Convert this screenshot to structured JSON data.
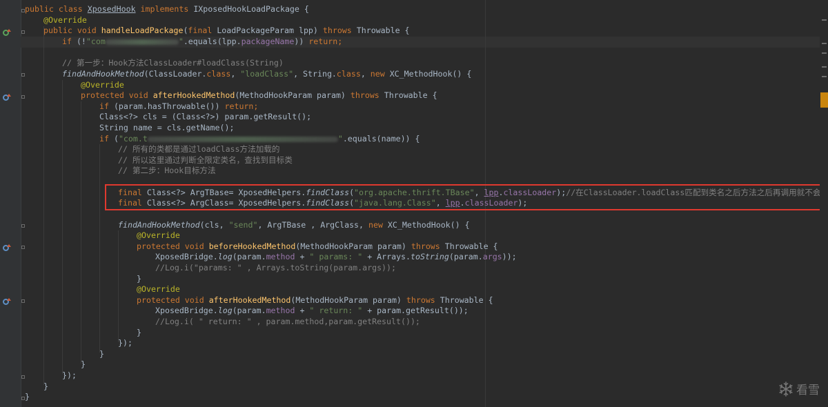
{
  "code": {
    "l1": {
      "t1": "public class ",
      "t2": "XposedHook",
      "t3": " implements ",
      "t4": "IXposedHookLoadPackage {"
    },
    "l2": {
      "t1": "@Override"
    },
    "l3": {
      "t1": "public void ",
      "t2": "handleLoadPackage",
      "t3": "(",
      "t4": "final ",
      "t5": "LoadPackageParam lpp) ",
      "t6": "throws ",
      "t7": "Throwable {"
    },
    "l4": {
      "t1": "if ",
      "t2": "(!",
      "t3": "\"com",
      "t4": "\"",
      "t5": ".equals(lpp.",
      "t6": "packageName",
      "t7": ")) ",
      "t8": "return;"
    },
    "l6": {
      "t1": "// 第一步：Hook方法ClassLoader#loadClass(String)"
    },
    "l7": {
      "t1": "findAndHookMethod",
      "t2": "(ClassLoader.",
      "t3": "class",
      "t4": ", ",
      "t5": "\"loadClass\"",
      "t6": ", String.",
      "t7": "class",
      "t8": ", ",
      "t9": "new ",
      "t10": "XC_MethodHook() {"
    },
    "l8": {
      "t1": "@Override"
    },
    "l9": {
      "t1": "protected void ",
      "t2": "afterHookedMethod",
      "t3": "(MethodHookParam param) ",
      "t4": "throws ",
      "t5": "Throwable {"
    },
    "l10": {
      "t1": "if ",
      "t2": "(param.hasThrowable()) ",
      "t3": "return;"
    },
    "l11": {
      "t1": "Class<?> cls = (Class<?>) param.getResult();"
    },
    "l12": {
      "t1": "String name = cls.getName();"
    },
    "l13": {
      "t1": "if ",
      "t2": "(",
      "t3": "\"com.t",
      "t4": "\"",
      "t5": ".equals(name)) {"
    },
    "l14": {
      "t1": "// 所有的类都是通过loadClass方法加载的"
    },
    "l15": {
      "t1": "// 所以这里通过判断全限定类名，查找到目标类"
    },
    "l16": {
      "t1": "// 第二步：Hook目标方法"
    },
    "l18": {
      "t1": "final ",
      "t2": "Class<?> ArgTBase= XposedHelpers.",
      "t3": "findClass",
      "t4": "(",
      "t5": "\"org.apache.thrift.TBase\"",
      "t6": ", ",
      "t7": "lpp",
      "t8": ".",
      "t9": "classLoader",
      "t10": ");",
      "t11": "//在ClassLoader.loadClass匹配到类名之后方法之后再调用就不会报错"
    },
    "l19": {
      "t1": "final ",
      "t2": "Class<?> ArgClass= XposedHelpers.",
      "t3": "findClass",
      "t4": "(",
      "t5": "\"java.lang.Class\"",
      "t6": ", ",
      "t7": "lpp",
      "t8": ".",
      "t9": "classLoader",
      "t10": ");"
    },
    "l21": {
      "t1": "findAndHookMethod",
      "t2": "(cls, ",
      "t3": "\"send\"",
      "t4": ", ArgTBase , ArgClass, ",
      "t5": "new ",
      "t6": "XC_MethodHook() {"
    },
    "l22": {
      "t1": "@Override"
    },
    "l23": {
      "t1": "protected void ",
      "t2": "beforeHookedMethod",
      "t3": "(MethodHookParam param) ",
      "t4": "throws ",
      "t5": "Throwable {"
    },
    "l24": {
      "t1": "XposedBridge.",
      "t2": "log",
      "t3": "(param.",
      "t4": "method ",
      "t5": "+ ",
      "t6": "\" params: \" ",
      "t7": "+ Arrays.",
      "t8": "toString",
      "t9": "(param.",
      "t10": "args",
      "t11": "));"
    },
    "l25": {
      "t1": "//Log.i(\"params: \" , Arrays.toString(param.args));"
    },
    "l26": {
      "t1": "}"
    },
    "l27": {
      "t1": "@Override"
    },
    "l28": {
      "t1": "protected void ",
      "t2": "afterHookedMethod",
      "t3": "(MethodHookParam param) ",
      "t4": "throws ",
      "t5": "Throwable {"
    },
    "l29": {
      "t1": "XposedBridge.",
      "t2": "log",
      "t3": "(param.",
      "t4": "method ",
      "t5": "+ ",
      "t6": "\" return: \" ",
      "t7": "+ param.getResult());"
    },
    "l30": {
      "t1": "//Log.i( \" return: \" , param.method,param.getResult());"
    },
    "l31": {
      "t1": "}"
    },
    "l32": {
      "t1": "});"
    },
    "l33": {
      "t1": "}"
    },
    "l34": {
      "t1": "}"
    },
    "l35": {
      "t1": "});"
    },
    "l36": {
      "t1": "}"
    },
    "l37": {
      "t1": "}"
    }
  },
  "watermark": {
    "text": "看雪"
  },
  "colors": {
    "background": "#2b2b2b",
    "keyword": "#cc7832",
    "annotation": "#bbb529",
    "string": "#6a8759",
    "comment": "#808080",
    "field": "#9876aa",
    "highlight_box": "#e0392f",
    "scroll_thumb": "#c9850e"
  },
  "icons": [
    "override-method-icon",
    "implements-method-icon",
    "fold-marker-icon",
    "snowflake-logo-icon"
  ]
}
